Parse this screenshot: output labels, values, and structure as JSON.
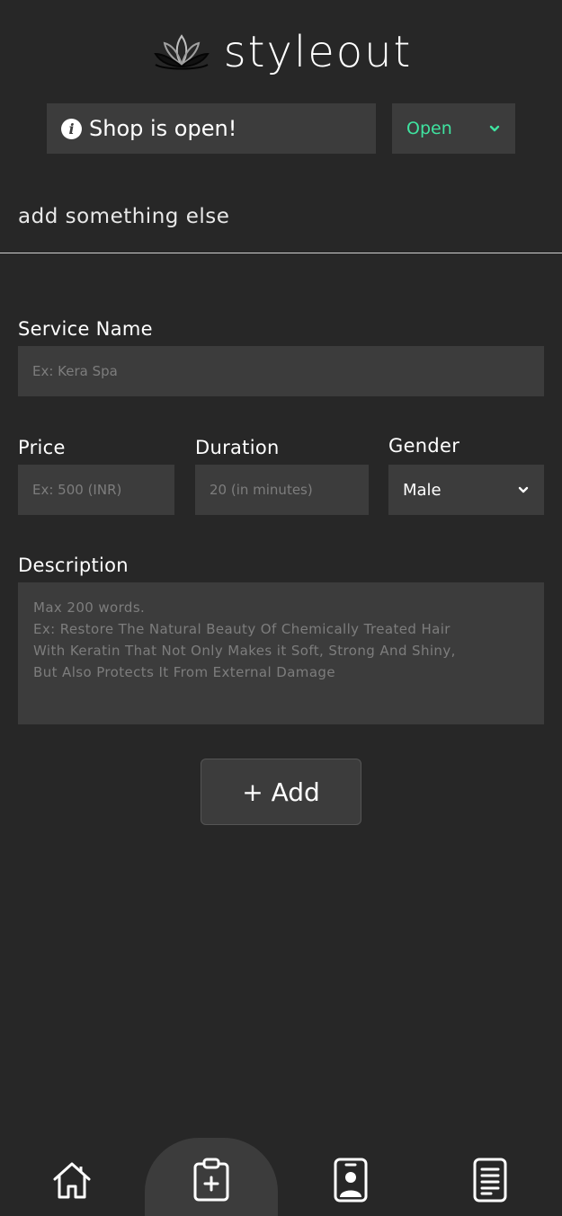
{
  "app": {
    "name": "styleout"
  },
  "status": {
    "message": "Shop is open!",
    "select_value": "Open",
    "accent_color": "#3fe3a0"
  },
  "section": {
    "title": "add something else"
  },
  "form": {
    "service_name": {
      "label": "Service Name",
      "placeholder": "Ex: Kera Spa"
    },
    "price": {
      "label": "Price",
      "placeholder": "Ex: 500 (INR)"
    },
    "duration": {
      "label": "Duration",
      "placeholder": "20 (in minutes)"
    },
    "gender": {
      "label": "Gender",
      "value": "Male"
    },
    "description": {
      "label": "Description",
      "placeholder": "Max 200 words.\nEx: Restore The Natural Beauty Of Chemically Treated Hair With Keratin That Not Only Makes it Soft, Strong And Shiny, But Also Protects It From External Damage"
    },
    "add_button": "+ Add"
  },
  "nav": {
    "items": [
      {
        "icon": "home-icon",
        "active": false
      },
      {
        "icon": "clipboard-add-icon",
        "active": true
      },
      {
        "icon": "profile-badge-icon",
        "active": false
      },
      {
        "icon": "document-icon",
        "active": false
      }
    ]
  }
}
